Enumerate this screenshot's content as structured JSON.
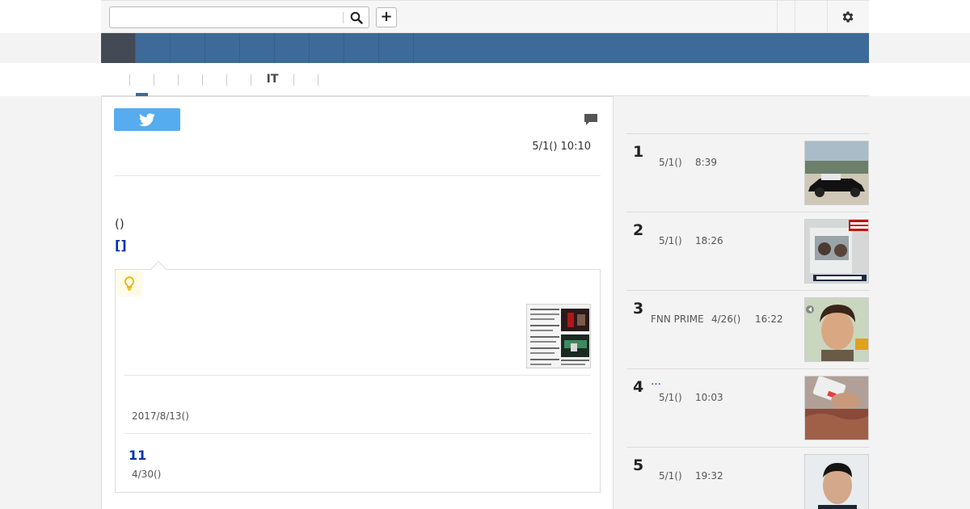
{
  "header": {
    "search": {
      "value": "",
      "placeholder": ""
    },
    "plus_label": "+"
  },
  "nav": {
    "items": [
      "",
      "",
      "",
      "",
      "",
      "",
      "",
      "",
      ""
    ]
  },
  "subnav": {
    "tabs": [
      "",
      "",
      "",
      "",
      "",
      "IT",
      "",
      ""
    ]
  },
  "article": {
    "date": "5/1() 10:10",
    "paren_text": "()",
    "bracket_link": "[]",
    "related": {
      "date1": "2017/8/13()",
      "number_link": "11",
      "date2": "4/30()"
    }
  },
  "ranking": {
    "items": [
      {
        "rank": "1",
        "source": "",
        "date": "5/1()",
        "time": "8:39",
        "link": ""
      },
      {
        "rank": "2",
        "source": "",
        "date": "5/1()",
        "time": "18:26",
        "link": ""
      },
      {
        "rank": "3",
        "source": "FNN PRIME",
        "date": "4/26()",
        "time": "16:22",
        "link": ""
      },
      {
        "rank": "4",
        "source": "",
        "date": "5/1()",
        "time": "10:03",
        "link": "…"
      },
      {
        "rank": "5",
        "source": "",
        "date": "5/1()",
        "time": "19:32",
        "link": ""
      }
    ]
  },
  "colors": {
    "nav_blue": "#3d6a98",
    "nav_active": "#434a56",
    "link_blue": "#0033aa",
    "twitter_blue": "#55acee"
  }
}
